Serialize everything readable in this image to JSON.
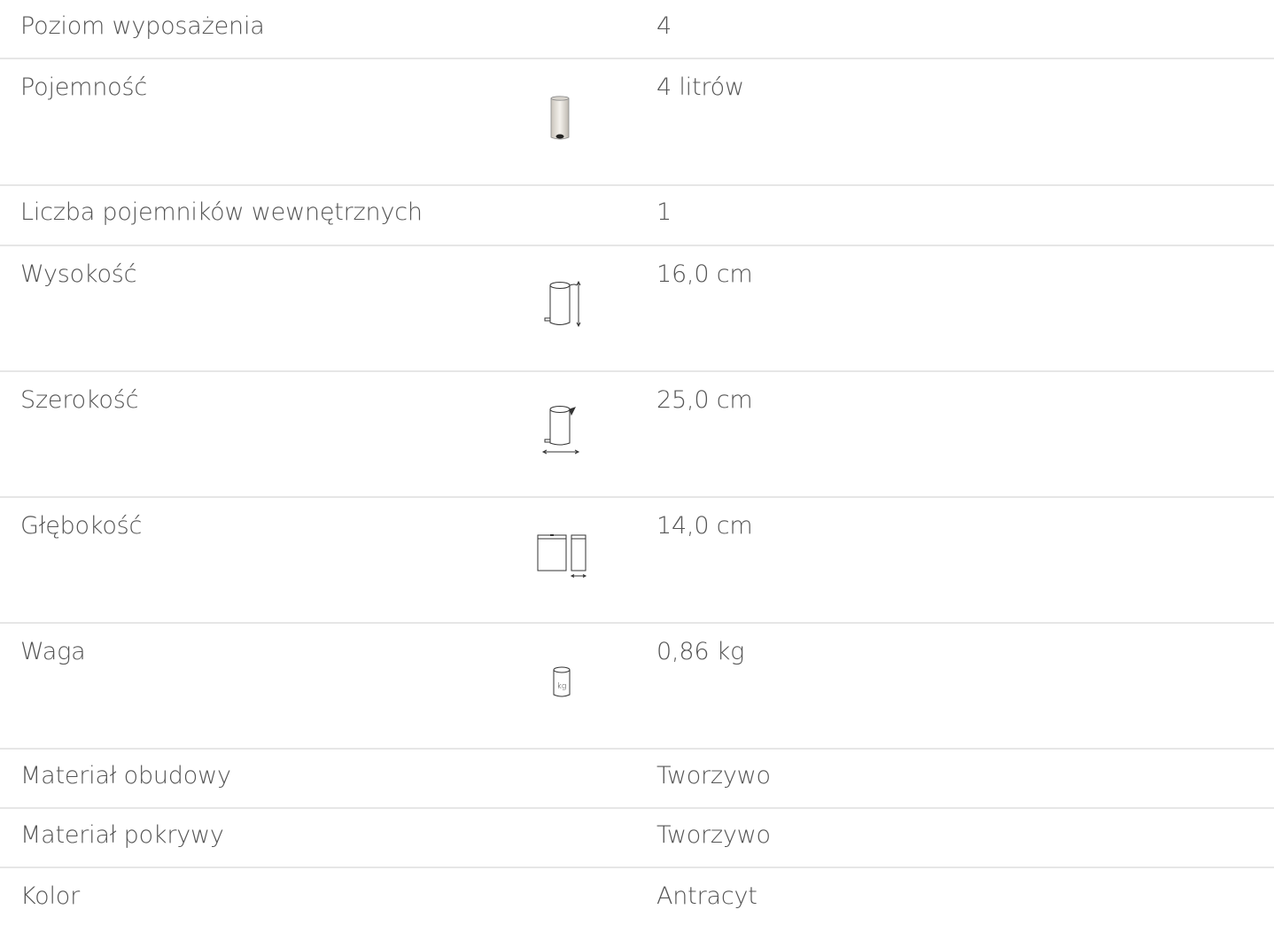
{
  "specs": {
    "rows": [
      {
        "label": "Poziom wyposażenia",
        "value": "4"
      },
      {
        "label": "Pojemność",
        "value": "4 litrów",
        "icon": "bin-capacity-icon"
      },
      {
        "label": "Liczba pojemników wewnętrznych",
        "value": "1"
      },
      {
        "label": "Wysokość",
        "value": "16,0 cm",
        "icon": "bin-height-icon"
      },
      {
        "label": "Szerokość",
        "value": "25,0 cm",
        "icon": "bin-width-icon"
      },
      {
        "label": "Głębokość",
        "value": "14,0 cm",
        "icon": "bin-depth-icon"
      },
      {
        "label": "Waga",
        "value": "0,86 kg",
        "icon": "bin-weight-icon",
        "icon_text": "kg"
      },
      {
        "label": "Materiał obudowy",
        "value": "Tworzywo"
      },
      {
        "label": "Materiał pokrywy",
        "value": "Tworzywo"
      },
      {
        "label": "Kolor",
        "value": "Antracyt"
      }
    ]
  },
  "colors": {
    "text": "#555555",
    "divider": "#e6e6e6",
    "icon_stroke": "#333333"
  }
}
